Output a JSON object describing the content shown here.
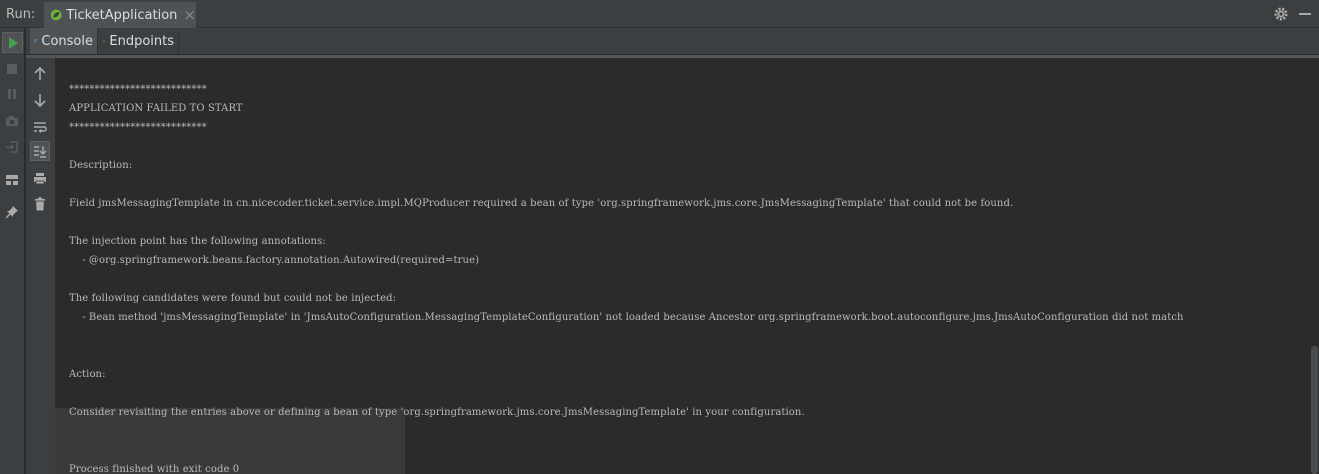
{
  "titlebar": {
    "run_label": "Run:",
    "tab_title": "TicketApplication",
    "tab_close": "×",
    "icons": [
      "spring-leaf-icon",
      "close-icon",
      "gear-icon",
      "minimize-icon"
    ]
  },
  "tabs": [
    {
      "label": "Console",
      "icon": "console-icon",
      "selected": true
    },
    {
      "label": "Endpoints",
      "icon": "endpoints-icon",
      "selected": false
    }
  ],
  "toolbar": {
    "left_rail": [
      "rerun-icon",
      "stop-icon",
      "pause-icon",
      "camera-icon",
      "exit-icon",
      "layout-icon",
      "pin-icon"
    ],
    "tool_rail": [
      "up-arrow-icon",
      "down-arrow-icon",
      "soft-wrap-icon",
      "scroll-to-end-icon",
      "print-icon",
      "trash-icon"
    ]
  },
  "console": {
    "lines": [
      "***************************",
      "APPLICATION FAILED TO START",
      "***************************",
      "Description:",
      "Field jmsMessagingTemplate in cn.nicecoder.ticket.service.impl.MQProducer required a bean of type 'org.springframework.jms.core.JmsMessagingTemplate' that could not be found.",
      "The injection point has the following annotations:",
      "    - @org.springframework.beans.factory.annotation.Autowired(required=true)",
      "The following candidates were found but could not be injected:",
      "    - Bean method 'jmsMessagingTemplate' in 'JmsAutoConfiguration.MessagingTemplateConfiguration' not loaded because Ancestor org.springframework.boot.autoconfigure.jms.JmsAutoConfiguration did not match",
      "Action:",
      "Consider revisiting the entries above or defining a bean of type 'org.springframework.jms.core.JmsMessagingTemplate' in your configuration.",
      "Process finished with exit code 0"
    ]
  },
  "colors": {
    "background": "#2b2b2b",
    "panel": "#3c3f41",
    "text": "#bbbbbb",
    "run_green": "#499c54",
    "spring_green": "#6db33f",
    "endpoints_orange": "#e8a33d"
  }
}
